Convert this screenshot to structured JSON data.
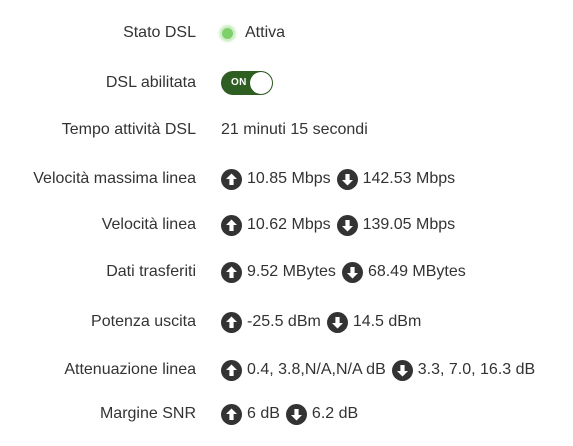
{
  "colors": {
    "status_active": "#7ed06b",
    "toggle_on": "#2e5e22",
    "arrow_icon": "#333333",
    "text": "#333333"
  },
  "stato_dsl": {
    "label": "Stato DSL",
    "value": "Attiva"
  },
  "dsl_abilitata": {
    "label": "DSL abilitata",
    "toggle_text": "ON",
    "enabled": true
  },
  "tempo_attivita": {
    "label": "Tempo attività DSL",
    "value": "21 minuti 15 secondi"
  },
  "velocita_massima": {
    "label": "Velocità massima linea",
    "up": "10.85 Mbps",
    "down": "142.53 Mbps"
  },
  "velocita_linea": {
    "label": "Velocità linea",
    "up": "10.62 Mbps",
    "down": "139.05 Mbps"
  },
  "dati_trasferiti": {
    "label": "Dati trasferiti",
    "up": "9.52 MBytes",
    "down": "68.49 MBytes"
  },
  "potenza_uscita": {
    "label": "Potenza uscita",
    "up": "-25.5 dBm",
    "down": "14.5 dBm"
  },
  "attenuazione": {
    "label": "Attenuazione linea",
    "up": "0.4, 3.8,N/A,N/A dB",
    "down": "3.3, 7.0, 16.3 dB"
  },
  "margine_snr": {
    "label": "Margine SNR",
    "up": "6 dB",
    "down": "6.2 dB"
  },
  "icons": {
    "up": "arrow-up-circle-icon",
    "down": "arrow-down-circle-icon",
    "status": "status-dot-icon"
  }
}
